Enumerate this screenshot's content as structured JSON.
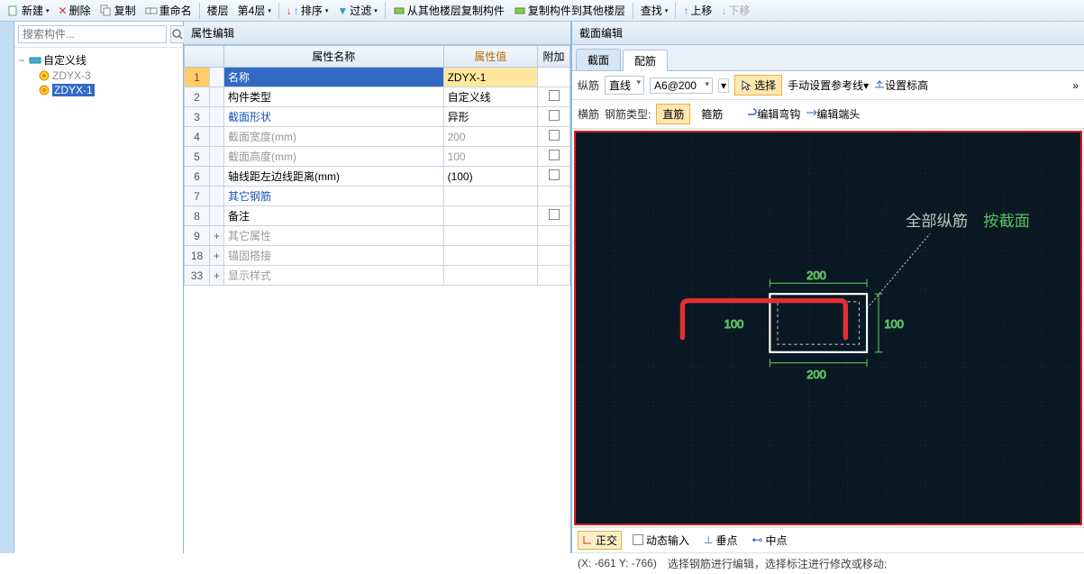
{
  "toolbar": {
    "new": "新建",
    "delete": "删除",
    "copy": "复制",
    "rename": "重命名",
    "floor": "楼层",
    "floor_level": "第4层",
    "sort": "排序",
    "filter": "过滤",
    "copy_from": "从其他楼层复制构件",
    "copy_to": "复制构件到其他楼层",
    "find": "查找",
    "up": "上移",
    "down": "下移"
  },
  "search": {
    "placeholder": "搜索构件..."
  },
  "tree": {
    "root": "自定义线",
    "items": [
      "ZDYX-3",
      "ZDYX-1"
    ]
  },
  "prop_panel": {
    "title": "属性编辑",
    "headers": {
      "name": "属性名称",
      "value": "属性值",
      "extra": "附加"
    },
    "rows": [
      {
        "num": "1",
        "name": "名称",
        "value": "ZDYX-1",
        "selected": true,
        "chk": false
      },
      {
        "num": "2",
        "name": "构件类型",
        "value": "自定义线",
        "chk": true
      },
      {
        "num": "3",
        "name": "截面形状",
        "value": "异形",
        "link": true,
        "chk": true
      },
      {
        "num": "4",
        "name": "截面宽度(mm)",
        "value": "200",
        "disabled": true,
        "chk": true
      },
      {
        "num": "5",
        "name": "截面高度(mm)",
        "value": "100",
        "disabled": true,
        "chk": true
      },
      {
        "num": "6",
        "name": "轴线距左边线距离(mm)",
        "value": "(100)",
        "chk": true
      },
      {
        "num": "7",
        "name": "其它钢筋",
        "value": "",
        "link": true,
        "chk": false
      },
      {
        "num": "8",
        "name": "备注",
        "value": "",
        "chk": true
      },
      {
        "num": "9",
        "name": "其它属性",
        "value": "",
        "group": true
      },
      {
        "num": "18",
        "name": "锚固搭接",
        "value": "",
        "group": true
      },
      {
        "num": "33",
        "name": "显示样式",
        "value": "",
        "group": true
      }
    ]
  },
  "section": {
    "title": "截面编辑",
    "tabs": [
      "截面",
      "配筋"
    ],
    "tb1": {
      "longit": "纵筋",
      "line": "直线",
      "rebar": "A6@200",
      "select": "选择",
      "manual_ref": "手动设置参考线",
      "set_elev": "设置标高"
    },
    "tb2": {
      "transv": "横筋",
      "rebar_type": "钢筋类型:",
      "straight": "直筋",
      "stirrup": "箍筋",
      "edit_hook": "编辑弯钩",
      "edit_end": "编辑端头"
    },
    "canvas": {
      "annot1": "全部纵筋",
      "annot2": "按截面",
      "dim_w": "200",
      "dim_h": "100"
    },
    "status": {
      "ortho": "正交",
      "dyn": "动态输入",
      "perp": "垂点",
      "mid": "中点"
    },
    "coords": "(X: -661 Y: -766)",
    "hint": "选择钢筋进行编辑，选择标注进行修改或移动;"
  }
}
